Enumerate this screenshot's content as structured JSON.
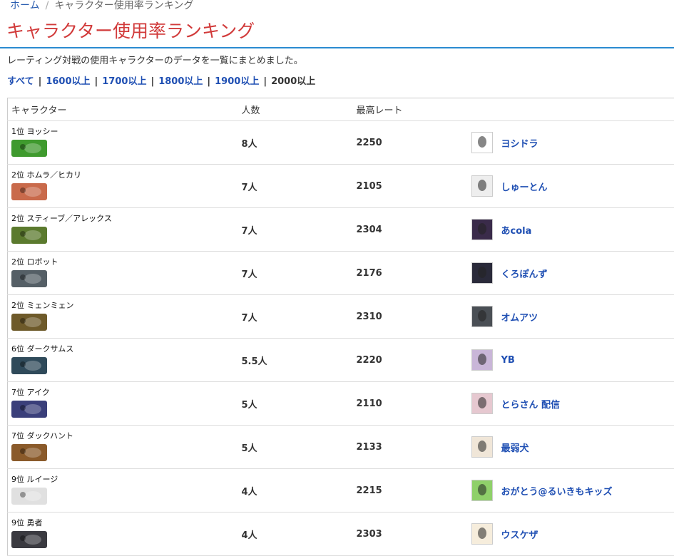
{
  "breadcrumb": {
    "home": "ホーム",
    "current": "キャラクター使用率ランキング"
  },
  "page": {
    "title": "キャラクター使用率ランキング",
    "description": "レーティング対戦の使用キャラクターのデータを一覧にまとめました。"
  },
  "filters": [
    {
      "label": "すべて",
      "active": false
    },
    {
      "label": "1600以上",
      "active": false
    },
    {
      "label": "1700以上",
      "active": false
    },
    {
      "label": "1800以上",
      "active": false
    },
    {
      "label": "1900以上",
      "active": false
    },
    {
      "label": "2000以上",
      "active": true
    }
  ],
  "table": {
    "headers": {
      "character": "キャラクター",
      "count": "人数",
      "max_rate": "最高レート"
    },
    "rows": [
      {
        "rank_name": "1位 ヨッシー",
        "count": "8人",
        "max_rate": "2250",
        "player": "ヨシドラ",
        "char_color": "#3f9a2e",
        "avatar_color": "#ffffff"
      },
      {
        "rank_name": "2位 ホムラ／ヒカリ",
        "count": "7人",
        "max_rate": "2105",
        "player": "しゅーとん",
        "char_color": "#c96a4b",
        "avatar_color": "#eeeeee"
      },
      {
        "rank_name": "2位 スティーブ／アレックス",
        "count": "7人",
        "max_rate": "2304",
        "player": "あcola",
        "char_color": "#5b7a2e",
        "avatar_color": "#3a2b4a"
      },
      {
        "rank_name": "2位 ロボット",
        "count": "7人",
        "max_rate": "2176",
        "player": "くろぽんず",
        "char_color": "#555f66",
        "avatar_color": "#2a2a3a"
      },
      {
        "rank_name": "2位 ミェンミェン",
        "count": "7人",
        "max_rate": "2310",
        "player": "オムアツ",
        "char_color": "#6e5a2a",
        "avatar_color": "#4a4f55"
      },
      {
        "rank_name": "6位 ダークサムス",
        "count": "5.5人",
        "max_rate": "2220",
        "player": "YB",
        "char_color": "#2f4a5a",
        "avatar_color": "#c9b6d8"
      },
      {
        "rank_name": "7位 アイク",
        "count": "5人",
        "max_rate": "2110",
        "player": "とらさん 配信",
        "char_color": "#3a3f7a",
        "avatar_color": "#e6c8d0"
      },
      {
        "rank_name": "7位 ダックハント",
        "count": "5人",
        "max_rate": "2133",
        "player": "最弱犬",
        "char_color": "#8a5a2a",
        "avatar_color": "#f0e6d8"
      },
      {
        "rank_name": "9位 ルイージ",
        "count": "4人",
        "max_rate": "2215",
        "player": "おがとう@るいきもキッズ",
        "char_color": "#e0e0e0",
        "avatar_color": "#8fd06a"
      },
      {
        "rank_name": "9位 勇者",
        "count": "4人",
        "max_rate": "2303",
        "player": "ウスケザ",
        "char_color": "#3a3a40",
        "avatar_color": "#f6eddc"
      }
    ]
  },
  "colors": {
    "title": "#d13a3a",
    "link": "#1f4fb3",
    "rule": "#2b8bd1"
  }
}
